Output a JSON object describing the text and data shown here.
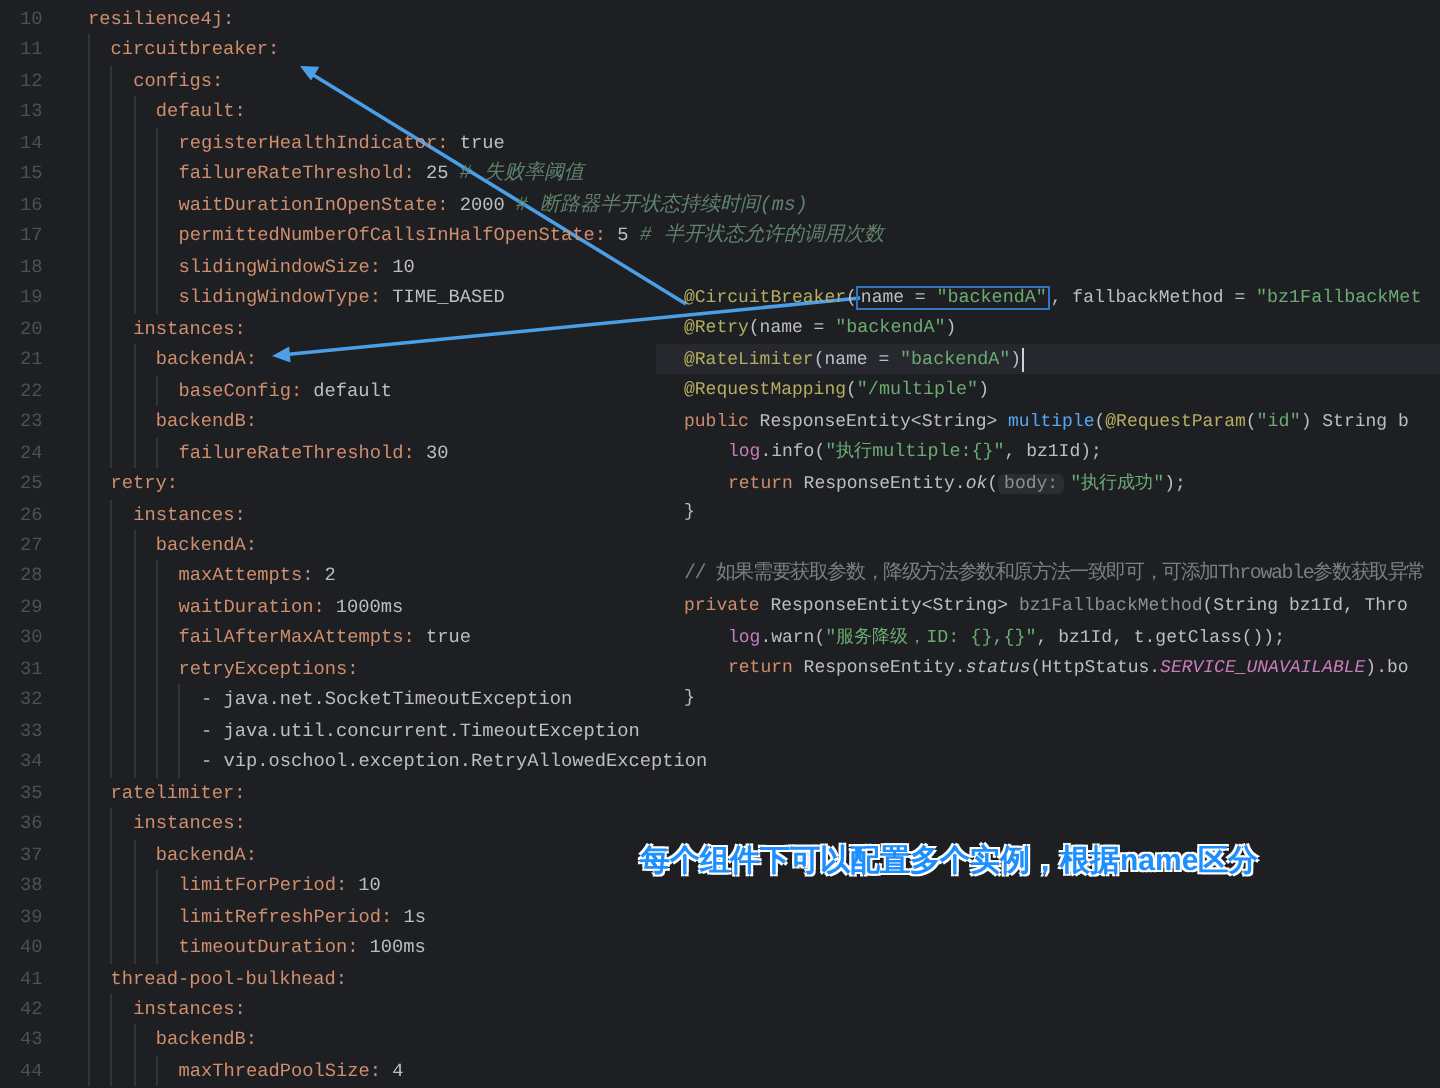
{
  "editor": {
    "yaml": [
      {
        "line": "10",
        "kind": "key",
        "key": "resilience4j:",
        "children": [
          {
            "line": "11",
            "kind": "key",
            "key": "circuitbreaker:",
            "children": [
              {
                "line": "12",
                "kind": "key",
                "key": "configs:",
                "children": [
                  {
                    "line": "13",
                    "kind": "key",
                    "key": "default:",
                    "children": [
                      {
                        "line": "14",
                        "kind": "key",
                        "key": "registerHealthIndicator:",
                        "value": "true"
                      },
                      {
                        "line": "15",
                        "kind": "key",
                        "key": "failureRateThreshold:",
                        "value": "25",
                        "comment": "# 失败率阈值"
                      },
                      {
                        "line": "16",
                        "kind": "key",
                        "key": "waitDurationInOpenState:",
                        "value": "2000",
                        "comment": "# 断路器半开状态持续时间(ms)"
                      },
                      {
                        "line": "17",
                        "kind": "key",
                        "key": "permittedNumberOfCallsInHalfOpenState:",
                        "value": "5",
                        "comment": "# 半开状态允许的调用次数"
                      },
                      {
                        "line": "18",
                        "kind": "key",
                        "key": "slidingWindowSize:",
                        "value": "10"
                      },
                      {
                        "line": "19",
                        "kind": "key",
                        "key": "slidingWindowType:",
                        "value": "TIME_BASED"
                      }
                    ]
                  }
                ]
              },
              {
                "line": "20",
                "kind": "key",
                "key": "instances:",
                "children": [
                  {
                    "line": "21",
                    "kind": "key",
                    "key": "backendA:",
                    "children": [
                      {
                        "line": "22",
                        "kind": "key",
                        "key": "baseConfig:",
                        "value": "default"
                      }
                    ]
                  },
                  {
                    "line": "23",
                    "kind": "key",
                    "key": "backendB:",
                    "children": [
                      {
                        "line": "24",
                        "kind": "key",
                        "key": "failureRateThreshold:",
                        "value": "30"
                      }
                    ]
                  }
                ]
              }
            ]
          },
          {
            "line": "25",
            "kind": "key",
            "key": "retry:",
            "children": [
              {
                "line": "26",
                "kind": "key",
                "key": "instances:",
                "children": [
                  {
                    "line": "27",
                    "kind": "key",
                    "key": "backendA:",
                    "children": [
                      {
                        "line": "28",
                        "kind": "key",
                        "key": "maxAttempts:",
                        "value": "2"
                      },
                      {
                        "line": "29",
                        "kind": "key",
                        "key": "waitDuration:",
                        "value": "1000ms"
                      },
                      {
                        "line": "30",
                        "kind": "key",
                        "key": "failAfterMaxAttempts:",
                        "value": "true"
                      },
                      {
                        "line": "31",
                        "kind": "key",
                        "key": "retryExceptions:",
                        "children": [
                          {
                            "line": "32",
                            "kind": "item",
                            "text": "- java.net.SocketTimeoutException"
                          },
                          {
                            "line": "33",
                            "kind": "item",
                            "text": "- java.util.concurrent.TimeoutException"
                          },
                          {
                            "line": "34",
                            "kind": "item",
                            "text": "- vip.oschool.exception.RetryAllowedException"
                          }
                        ]
                      }
                    ]
                  }
                ]
              }
            ]
          },
          {
            "line": "35",
            "kind": "key",
            "key": "ratelimiter:",
            "children": [
              {
                "line": "36",
                "kind": "key",
                "key": "instances:",
                "children": [
                  {
                    "line": "37",
                    "kind": "key",
                    "key": "backendA:",
                    "children": [
                      {
                        "line": "38",
                        "kind": "key",
                        "key": "limitForPeriod:",
                        "value": "10"
                      },
                      {
                        "line": "39",
                        "kind": "key",
                        "key": "limitRefreshPeriod:",
                        "value": "1s"
                      },
                      {
                        "line": "40",
                        "kind": "key",
                        "key": "timeoutDuration:",
                        "value": "100ms"
                      }
                    ]
                  }
                ]
              }
            ]
          },
          {
            "line": "41",
            "kind": "key",
            "key": "thread-pool-bulkhead:",
            "children": [
              {
                "line": "42",
                "kind": "key",
                "key": "instances:",
                "children": [
                  {
                    "line": "43",
                    "kind": "key",
                    "key": "backendB:",
                    "children": [
                      {
                        "line": "44",
                        "kind": "key",
                        "key": "maxThreadPoolSize:",
                        "value": "4"
                      }
                    ]
                  }
                ]
              }
            ]
          }
        ]
      }
    ]
  },
  "overlay": {
    "blocks": [
      {
        "lines": [
          {
            "current": false,
            "tokens": [
              {
                "kind": "annotation",
                "text": "@CircuitBreaker"
              },
              {
                "kind": "plain",
                "text": "("
              },
              {
                "kind": "box",
                "tokens": [
                  {
                    "kind": "plain",
                    "text": "name = "
                  },
                  {
                    "kind": "string",
                    "text": "\"backendA\""
                  }
                ]
              },
              {
                "kind": "plain",
                "text": ", fallbackMethod = "
              },
              {
                "kind": "string",
                "text": "\"bz1FallbackMet"
              }
            ]
          },
          {
            "current": false,
            "tokens": [
              {
                "kind": "annotation",
                "text": "@Retry"
              },
              {
                "kind": "plain",
                "text": "(name = "
              },
              {
                "kind": "string",
                "text": "\"backendA\""
              },
              {
                "kind": "plain",
                "text": ")"
              }
            ]
          },
          {
            "current": true,
            "tokens": [
              {
                "kind": "annotation",
                "text": "@RateLimiter"
              },
              {
                "kind": "plain",
                "text": "(name = "
              },
              {
                "kind": "string",
                "text": "\"backendA\""
              },
              {
                "kind": "plain",
                "text": ")"
              }
            ]
          },
          {
            "current": false,
            "tokens": [
              {
                "kind": "annotation",
                "text": "@RequestMapping"
              },
              {
                "kind": "plain",
                "text": "("
              },
              {
                "kind": "string",
                "text": "\"/multiple\""
              },
              {
                "kind": "plain",
                "text": ")"
              }
            ]
          },
          {
            "current": false,
            "tokens": [
              {
                "kind": "keyword",
                "text": "public"
              },
              {
                "kind": "plain",
                "text": " ResponseEntity<String> "
              },
              {
                "kind": "method",
                "text": "multiple"
              },
              {
                "kind": "plain",
                "text": "("
              },
              {
                "kind": "annotation",
                "text": "@RequestParam"
              },
              {
                "kind": "plain",
                "text": "("
              },
              {
                "kind": "string",
                "text": "\"id\""
              },
              {
                "kind": "plain",
                "text": ") String b"
              }
            ],
            "children": [
              {
                "current": false,
                "tokens": [
                  {
                    "kind": "field",
                    "text": "log"
                  },
                  {
                    "kind": "plain",
                    "text": ".info("
                  },
                  {
                    "kind": "string",
                    "text": "\"执行multiple:{}\""
                  },
                  {
                    "kind": "plain",
                    "text": ", bz1Id);"
                  }
                ]
              },
              {
                "current": false,
                "tokens": [
                  {
                    "kind": "keyword",
                    "text": "return"
                  },
                  {
                    "kind": "plain",
                    "text": " ResponseEntity."
                  },
                  {
                    "kind": "italic",
                    "text": "ok"
                  },
                  {
                    "kind": "plain",
                    "text": "("
                  },
                  {
                    "kind": "hint",
                    "text": "body:"
                  },
                  {
                    "kind": "string",
                    "text": "\"执行成功\""
                  },
                  {
                    "kind": "plain",
                    "text": ");"
                  }
                ]
              }
            ]
          },
          {
            "current": false,
            "tokens": [
              {
                "kind": "plain",
                "text": "}"
              }
            ]
          }
        ]
      },
      {
        "lines": [
          {
            "current": false,
            "tokens": [
              {
                "kind": "comment",
                "text": "// 如果需要获取参数，降级方法参数和原方法一致即可，可添加Throwable参数获取异常"
              }
            ]
          },
          {
            "current": false,
            "tokens": [
              {
                "kind": "keyword",
                "text": "private"
              },
              {
                "kind": "plain",
                "text": " ResponseEntity<String> "
              },
              {
                "kind": "unused",
                "text": "bz1FallbackMethod"
              },
              {
                "kind": "plain",
                "text": "(String bz1Id, Thro"
              }
            ],
            "children": [
              {
                "current": false,
                "tokens": [
                  {
                    "kind": "field",
                    "text": "log"
                  },
                  {
                    "kind": "plain",
                    "text": ".warn("
                  },
                  {
                    "kind": "string",
                    "text": "\"服务降级，ID: {},{}\""
                  },
                  {
                    "kind": "plain",
                    "text": ", bz1Id, t.getClass());"
                  }
                ]
              },
              {
                "current": false,
                "tokens": [
                  {
                    "kind": "keyword",
                    "text": "return"
                  },
                  {
                    "kind": "plain",
                    "text": " ResponseEntity."
                  },
                  {
                    "kind": "italic",
                    "text": "status"
                  },
                  {
                    "kind": "plain",
                    "text": "(HttpStatus."
                  },
                  {
                    "kind": "constant",
                    "text": "SERVICE_UNAVAILABLE"
                  },
                  {
                    "kind": "plain",
                    "text": ").bo"
                  }
                ]
              }
            ]
          },
          {
            "current": false,
            "tokens": [
              {
                "kind": "plain",
                "text": "}"
              }
            ]
          }
        ]
      }
    ]
  },
  "annotation": {
    "text": "每个组件下可以配置多个实例，根据name区分"
  }
}
